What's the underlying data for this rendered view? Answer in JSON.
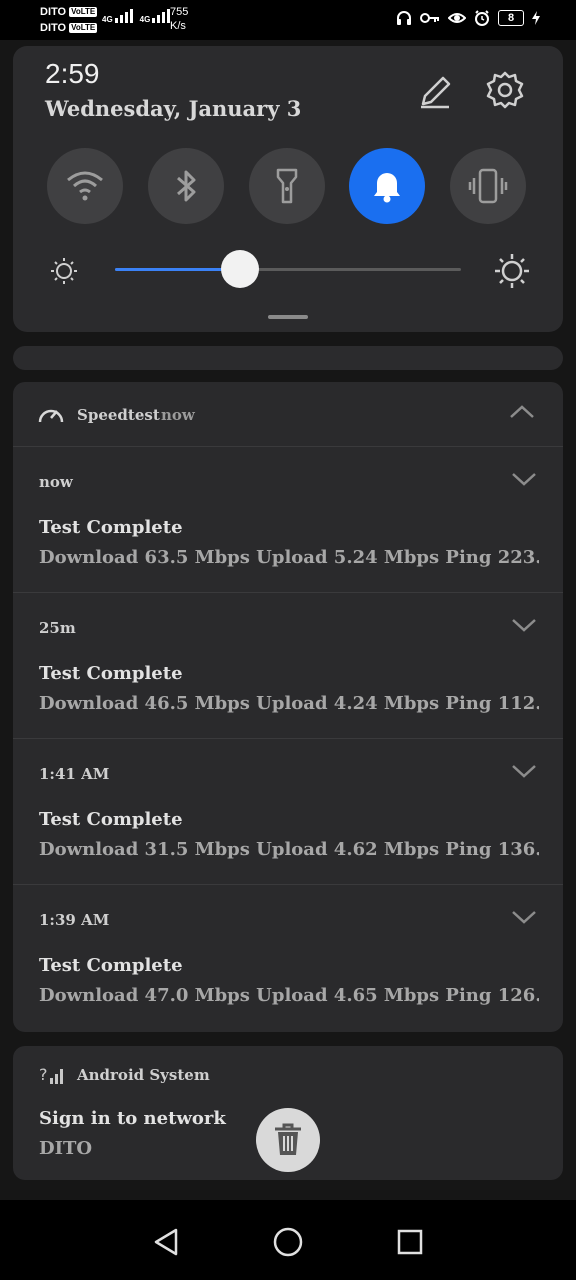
{
  "status_bar": {
    "carrier1": "DITO",
    "carrier2": "DITO",
    "volte": "VoLTE",
    "net1": "4G",
    "net2": "4G",
    "speed_value": "755",
    "speed_unit": "K/s",
    "battery": "8"
  },
  "quick_settings": {
    "time": "2:59",
    "date": "Wednesday, January 3",
    "tiles": [
      {
        "name": "wifi",
        "active": false
      },
      {
        "name": "bluetooth",
        "active": false
      },
      {
        "name": "flashlight",
        "active": false
      },
      {
        "name": "sound",
        "active": true
      },
      {
        "name": "vibrate",
        "active": false
      }
    ],
    "brightness_level": 0.36
  },
  "speedtest": {
    "app_name": "Speedtest",
    "time": "now",
    "notifications": [
      {
        "time": "now",
        "title": "Test Complete",
        "text": "Download 63.5 Mbps  Upload 5.24 Mbps  Ping 223.."
      },
      {
        "time": "25m",
        "title": "Test Complete",
        "text": "Download 46.5 Mbps  Upload 4.24 Mbps  Ping 112.."
      },
      {
        "time": "1:41 AM",
        "title": "Test Complete",
        "text": "Download 31.5 Mbps  Upload 4.62 Mbps  Ping 136.."
      },
      {
        "time": "1:39 AM",
        "title": "Test Complete",
        "text": "Download 47.0 Mbps  Upload 4.65 Mbps  Ping 126.."
      }
    ]
  },
  "android_system": {
    "app_name": "Android System",
    "title": "Sign in to network",
    "text": "DITO"
  },
  "colors": {
    "accent": "#1a6ff0",
    "panel": "#2b2b2d",
    "background": "#161616"
  }
}
